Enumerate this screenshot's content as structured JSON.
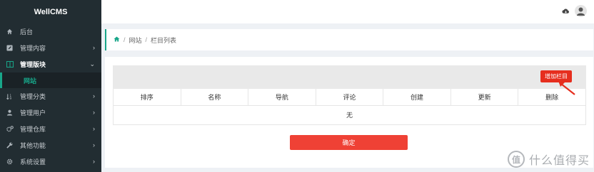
{
  "brand": "WellCMS",
  "sidebar": {
    "items": [
      {
        "label": "后台",
        "icon": "dashboard-icon",
        "chevron": ""
      },
      {
        "label": "管理内容",
        "icon": "edit-icon",
        "chevron": "›"
      },
      {
        "label": "管理版块",
        "icon": "columns-icon",
        "chevron": "⌄"
      },
      {
        "label": "管理分类",
        "icon": "sort-icon",
        "chevron": "›"
      },
      {
        "label": "管理用户",
        "icon": "user-icon",
        "chevron": "›"
      },
      {
        "label": "管理仓库",
        "icon": "cogs-icon",
        "chevron": "›"
      },
      {
        "label": "其他功能",
        "icon": "wrench-icon",
        "chevron": "›"
      },
      {
        "label": "系统设置",
        "icon": "gear-icon",
        "chevron": "›"
      }
    ],
    "subitem": "网站"
  },
  "breadcrumb": {
    "sep": "/",
    "items": [
      "网站",
      "栏目列表"
    ]
  },
  "toolbar": {
    "add_label": "增加栏目"
  },
  "table": {
    "columns": [
      "排序",
      "名称",
      "导航",
      "评论",
      "创建",
      "更新",
      "删除"
    ],
    "empty_text": "无"
  },
  "confirm_label": "确定",
  "watermark": {
    "badge": "值",
    "text": "什么值得买"
  },
  "colors": {
    "accent": "#18a689",
    "sidebar_bg": "#222d32",
    "add_button": "#e62e1e",
    "confirm_button": "#ef4135"
  }
}
